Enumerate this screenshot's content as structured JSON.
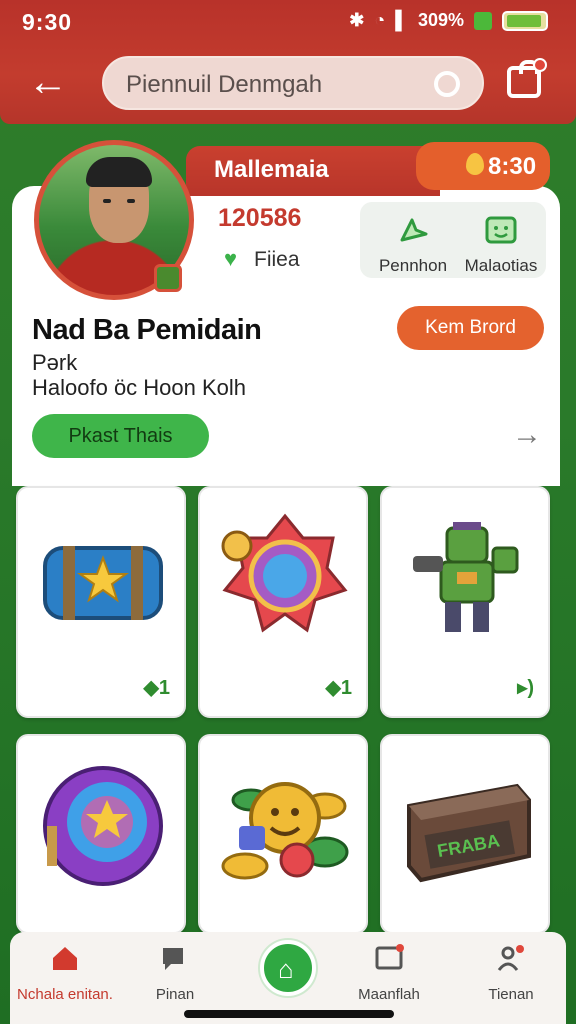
{
  "status_bar": {
    "time": "9:30",
    "battery_text": "309%"
  },
  "header": {
    "search_text": "Piennuil Denmgah",
    "icons": [
      "back-arrow-icon",
      "search-ring-icon",
      "shop-bag-icon"
    ]
  },
  "profile": {
    "band_name": "Mallemaia",
    "timer": "8:30",
    "stat_number": "120586",
    "stat_label": "Fiiea",
    "actions": [
      {
        "label": "Pennhon",
        "icon": "arrow-icon"
      },
      {
        "label": "Malaotias",
        "icon": "smile-box-icon"
      }
    ],
    "title": "Nad Ba Pemidain",
    "sub1": "Pərk",
    "sub2": "Haloofo  öc Hoon Kolh",
    "orange_button": "Kem Brord",
    "green_button": "Pkast Thais"
  },
  "items": [
    {
      "name": "blue-chest",
      "count": "◆1"
    },
    {
      "name": "gem-badge",
      "count": "◆1"
    },
    {
      "name": "robot-figure",
      "count": "▸)"
    },
    {
      "name": "purple-pouch",
      "count": ""
    },
    {
      "name": "coin-pile",
      "count": ""
    },
    {
      "name": "fraba-crate",
      "count": ""
    }
  ],
  "crate_text": "FRABA",
  "bottom_nav": [
    {
      "label": "Nchala enitan.",
      "icon": "home-icon",
      "active": true
    },
    {
      "label": "Pinan",
      "icon": "chat-icon",
      "active": false
    },
    {
      "label": "",
      "icon": "center-action-icon",
      "active": false
    },
    {
      "label": "Maanflah",
      "icon": "screen-icon",
      "active": false
    },
    {
      "label": "Tienan",
      "icon": "people-icon",
      "active": false
    }
  ],
  "colors": {
    "header_red": "#b8322a",
    "accent_orange": "#e4622e",
    "accent_green": "#3fb54a",
    "background_green": "#2a7a2a"
  }
}
